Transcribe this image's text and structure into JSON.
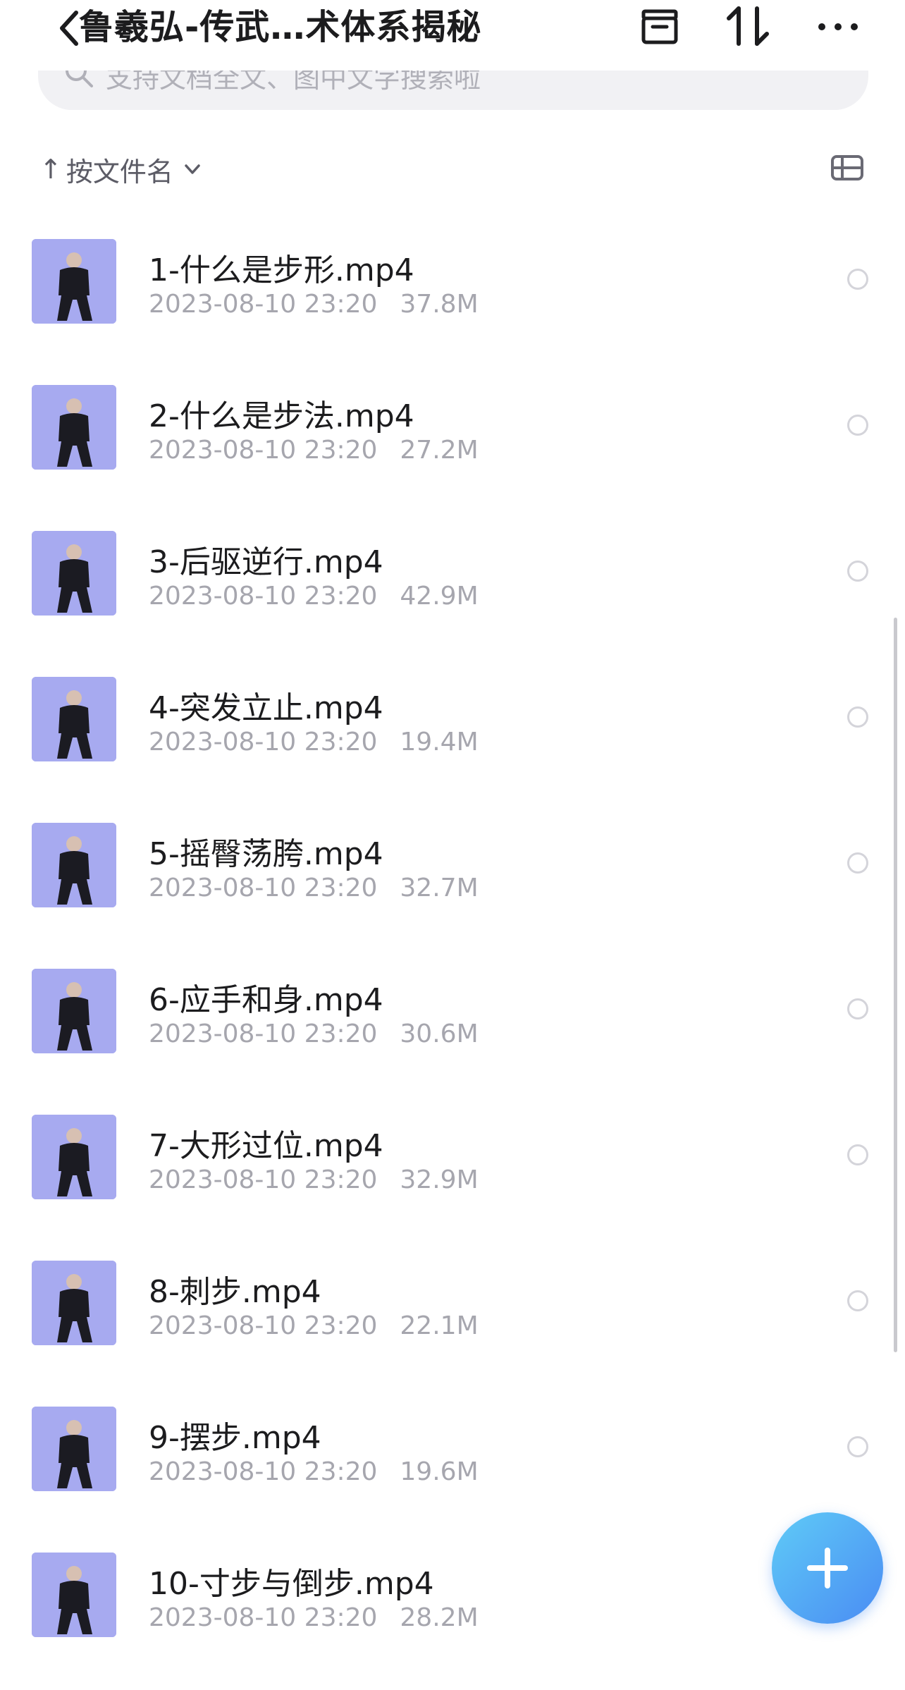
{
  "header": {
    "title": "鲁羲弘-传武…术体系揭秘",
    "back_icon": "chevron-left-icon",
    "archive_icon": "archive-box-icon",
    "sort_icon": "sort-arrows-icon",
    "more_icon": "more-dots-icon"
  },
  "search": {
    "placeholder": "支持文档全文、图中文字搜索啦",
    "icon": "search-icon"
  },
  "sort": {
    "arrow": "↑",
    "label": "按文件名",
    "chevron_icon": "chevron-down-icon",
    "view_icon": "list-view-toggle-icon"
  },
  "files": [
    {
      "name": "1-什么是步形.mp4",
      "date": "2023-08-10 23:20",
      "size": "37.8M"
    },
    {
      "name": "2-什么是步法.mp4",
      "date": "2023-08-10 23:20",
      "size": "27.2M"
    },
    {
      "name": "3-后驱逆行.mp4",
      "date": "2023-08-10 23:20",
      "size": "42.9M"
    },
    {
      "name": "4-突发立止.mp4",
      "date": "2023-08-10 23:20",
      "size": "19.4M"
    },
    {
      "name": "5-摇臀荡胯.mp4",
      "date": "2023-08-10 23:20",
      "size": "32.7M"
    },
    {
      "name": "6-应手和身.mp4",
      "date": "2023-08-10 23:20",
      "size": "30.6M"
    },
    {
      "name": "7-大形过位.mp4",
      "date": "2023-08-10 23:20",
      "size": "32.9M"
    },
    {
      "name": "8-刺步.mp4",
      "date": "2023-08-10 23:20",
      "size": "22.1M"
    },
    {
      "name": "9-摆步.mp4",
      "date": "2023-08-10 23:20",
      "size": "19.6M"
    },
    {
      "name": "10-寸步与倒步.mp4",
      "date": "2023-08-10 23:20",
      "size": "28.2M"
    }
  ],
  "fab": {
    "icon": "plus-icon"
  },
  "colors": {
    "accent": "#4a8cf3",
    "secondary_text": "#a6a6ae",
    "search_bg": "#f1f1f4"
  }
}
